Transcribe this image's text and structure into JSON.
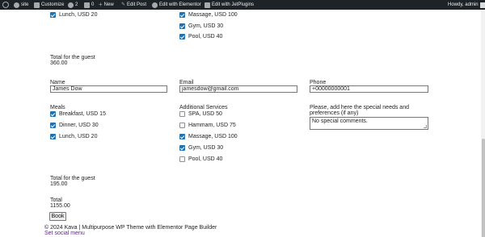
{
  "admin_bar": {
    "items": [
      {
        "label": "",
        "icon": "wordpress-logo-icon"
      },
      {
        "label": "site",
        "icon": "dashboard-icon"
      },
      {
        "label": "Customize",
        "icon": "brush-icon"
      },
      {
        "label": "2",
        "icon": "updates-icon"
      },
      {
        "label": "0",
        "icon": "comments-icon"
      },
      {
        "label": "New",
        "icon": "plus-icon"
      },
      {
        "label": "Edit Post",
        "icon": "pencil-icon"
      },
      {
        "label": "Edit with Elementor",
        "icon": "elementor-icon"
      },
      {
        "label": "Edit with JetPlugins",
        "icon": "jetplugins-icon"
      }
    ],
    "howdy": "Howdy, admin"
  },
  "top_section": {
    "meal_lunch": "Lunch, USD 20",
    "services": [
      "Massage, USD 100",
      "Gym, USD 30",
      "Pool, USD 40"
    ],
    "total_label": "Total for the guest",
    "total_value": "360.00"
  },
  "guest": {
    "name_label": "Name",
    "name_value": "James Dow",
    "email_label": "Email",
    "email_value": "jamesdow@gmail.com",
    "phone_label": "Phone",
    "phone_value": "+00000000001"
  },
  "meals": {
    "label": "Meals",
    "items": [
      {
        "label": "Breakfast, USD 15",
        "checked": true
      },
      {
        "label": "Dinner, USD 30",
        "checked": true
      },
      {
        "label": "Lunch, USD 20",
        "checked": true
      }
    ]
  },
  "services": {
    "label": "Additional Services",
    "items": [
      {
        "label": "SPA, USD 50",
        "checked": false
      },
      {
        "label": "Hammam, USD 75",
        "checked": false
      },
      {
        "label": "Massage, USD 100",
        "checked": true
      },
      {
        "label": "Gym, USD 30",
        "checked": true
      },
      {
        "label": "Pool, USD 40",
        "checked": false
      }
    ]
  },
  "special_needs": {
    "label_line1": "Please, add here the special needs and",
    "label_line2": "preferences (if any)",
    "value": "No special comments."
  },
  "guest_total": {
    "label": "Total for the guest",
    "value": "195.00"
  },
  "grand_total": {
    "label": "Total",
    "value": "1155.00"
  },
  "book_button": "Book",
  "footer": {
    "copyright": "© 2024 Kava | Multipurpose WP Theme with Elementor Page Builder",
    "social_menu": "Set social menu"
  }
}
